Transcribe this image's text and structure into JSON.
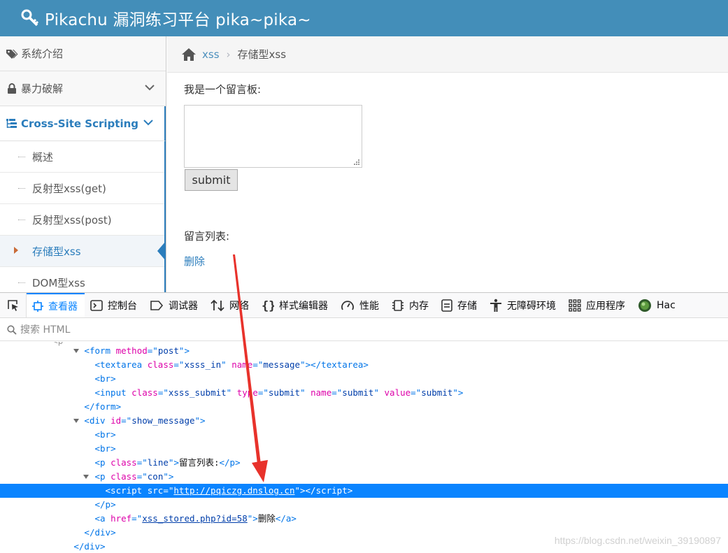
{
  "header": {
    "title": "Pikachu 漏洞练习平台 pika~pika~"
  },
  "sidebar": {
    "items": [
      {
        "label": "系统介绍"
      },
      {
        "label": "暴力破解"
      },
      {
        "label": "Cross-Site Scripting"
      }
    ],
    "sub_items": [
      {
        "label": "概述"
      },
      {
        "label": "反射型xss(get)"
      },
      {
        "label": "反射型xss(post)"
      },
      {
        "label": "存储型xss"
      },
      {
        "label": "DOM型xss"
      }
    ]
  },
  "breadcrumb": {
    "link": "xss",
    "separator": "›",
    "current": "存储型xss"
  },
  "main": {
    "board_label": "我是一个留言板:",
    "submit_label": "submit",
    "list_label": "留言列表:",
    "delete_label": "删除"
  },
  "devtools": {
    "tabs": [
      {
        "label": "查看器"
      },
      {
        "label": "控制台"
      },
      {
        "label": "调试器"
      },
      {
        "label": "网络"
      },
      {
        "label": "样式编辑器"
      },
      {
        "label": "性能"
      },
      {
        "label": "内存"
      },
      {
        "label": "存储"
      },
      {
        "label": "无障碍环境"
      },
      {
        "label": "应用程序"
      },
      {
        "label": "Hac"
      }
    ],
    "search_placeholder": "搜索 HTML",
    "tree": {
      "form_tag": "form",
      "form_method_attr": "method",
      "form_method_val": "post",
      "textarea_tag": "textarea",
      "class_attr": "class",
      "textarea_class": "xsss_in",
      "name_attr": "name",
      "textarea_name": "message",
      "br_tag": "br",
      "input_tag": "input",
      "input_class": "xsss_submit",
      "type_attr": "type",
      "input_type": "submit",
      "input_name": "submit",
      "value_attr": "value",
      "input_value": "submit",
      "div_tag": "div",
      "id_attr": "id",
      "div_id": "show_message",
      "p_tag": "p",
      "p_line_class": "line",
      "p_line_text": "留言列表:",
      "p_con_class": "con",
      "script_tag": "script",
      "src_attr": "src",
      "script_src": "http://pqiczg.dnslog.cn",
      "a_tag": "a",
      "href_attr": "href",
      "a_href": "xss_stored.php?id=58",
      "a_text": "删除"
    }
  },
  "watermark": "https://blog.csdn.net/weixin_39190897",
  "colors": {
    "header": "#438eb9",
    "accent": "#2b7dbc",
    "selection": "#0a84ff",
    "arrow": "#e8322b"
  }
}
